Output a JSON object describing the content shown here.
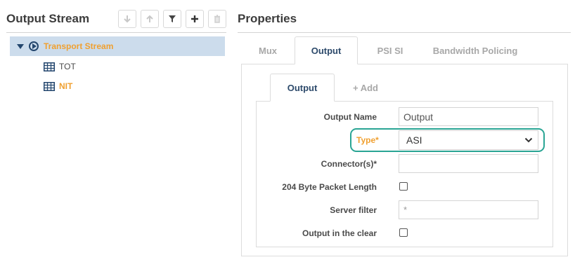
{
  "left_panel": {
    "title": "Output Stream",
    "toolbar": [
      {
        "name": "move-down-icon",
        "enabled": false
      },
      {
        "name": "move-up-icon",
        "enabled": false
      },
      {
        "name": "filter-icon",
        "enabled": true
      },
      {
        "name": "add-icon",
        "enabled": true
      },
      {
        "name": "delete-icon",
        "enabled": false
      }
    ],
    "tree": {
      "root": {
        "label": "Transport Stream",
        "expanded": true,
        "selected": true
      },
      "children": [
        {
          "label": "TOT",
          "icon": "table-icon"
        },
        {
          "label": "NIT",
          "icon": "table-icon"
        }
      ]
    }
  },
  "right_panel": {
    "title": "Properties",
    "tabs": [
      {
        "label": "Mux",
        "active": false
      },
      {
        "label": "Output",
        "active": true
      },
      {
        "label": "PSI SI",
        "active": false
      },
      {
        "label": "Bandwidth Policing",
        "active": false
      }
    ],
    "subtabs": [
      {
        "label": "Output",
        "active": true
      },
      {
        "label": "+ Add",
        "active": false
      }
    ],
    "form": {
      "output_name": {
        "label": "Output Name",
        "value": "Output"
      },
      "type": {
        "label": "Type*",
        "value": "ASI"
      },
      "connectors": {
        "label": "Connector(s)*",
        "value": ""
      },
      "byte204": {
        "label": "204 Byte Packet Length",
        "checked": false
      },
      "server_filter": {
        "label": "Server filter",
        "placeholder": "*"
      },
      "output_clear": {
        "label": "Output in the clear",
        "checked": false
      }
    }
  },
  "colors": {
    "accent_orange": "#f0a030",
    "selected_row": "#ccdcec",
    "active_tab_text": "#2d4a6b",
    "highlight_teal": "#2aa594"
  }
}
